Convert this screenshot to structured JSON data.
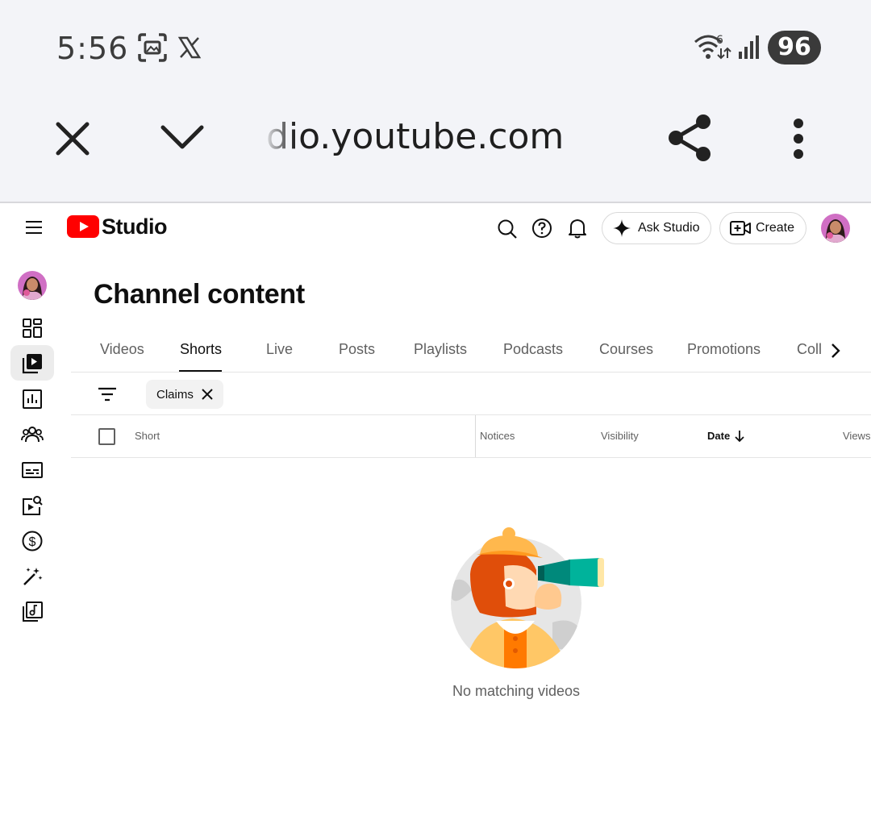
{
  "status_bar": {
    "time": "5:56",
    "battery": "96",
    "icons": [
      "screenshot-icon",
      "x-logo-icon",
      "wifi-icon",
      "signal-icon"
    ]
  },
  "browser": {
    "url": "dio.youtube.com",
    "icons": [
      "close-icon",
      "chevron-down-icon",
      "share-icon",
      "more-vert-icon"
    ]
  },
  "header": {
    "logo_text": "Studio",
    "ask_studio_label": "Ask Studio",
    "create_label": "Create",
    "brand_color": "#ff0000"
  },
  "sidebar": {
    "items": [
      {
        "icon": "dashboard-icon"
      },
      {
        "icon": "content-icon",
        "active": true
      },
      {
        "icon": "analytics-icon"
      },
      {
        "icon": "community-icon"
      },
      {
        "icon": "subtitles-icon"
      },
      {
        "icon": "copyright-icon"
      },
      {
        "icon": "earn-icon"
      },
      {
        "icon": "customization-icon"
      },
      {
        "icon": "audio-library-icon"
      }
    ]
  },
  "main": {
    "title": "Channel content",
    "tabs": [
      {
        "label": "Videos"
      },
      {
        "label": "Shorts",
        "active": true
      },
      {
        "label": "Live"
      },
      {
        "label": "Posts"
      },
      {
        "label": "Playlists"
      },
      {
        "label": "Podcasts"
      },
      {
        "label": "Courses"
      },
      {
        "label": "Promotions"
      },
      {
        "label": "Coll"
      }
    ],
    "filter_chip": "Claims",
    "columns": {
      "short": "Short",
      "notices": "Notices",
      "visibility": "Visibility",
      "date": "Date",
      "views": "Views"
    },
    "empty_message": "No matching videos"
  }
}
